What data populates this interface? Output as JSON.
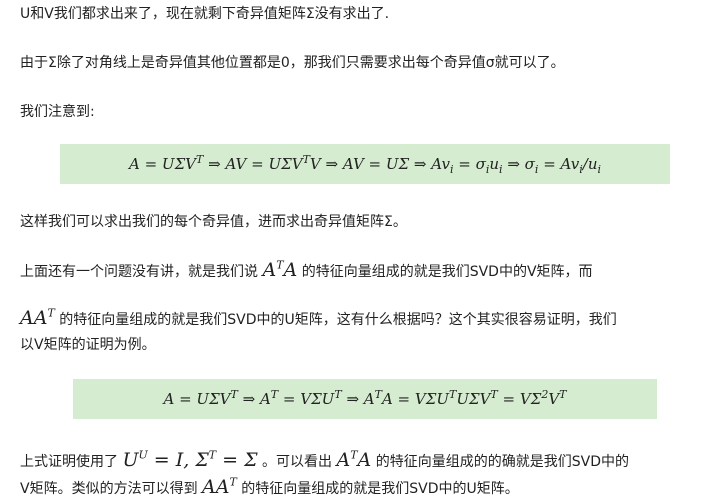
{
  "para1": "U和V我们都求出来了，现在就剩下奇异值矩阵Σ没有求出了.",
  "para2": "由于Σ除了对角线上是奇异值其他位置都是0，那我们只需要求出每个奇异值σ就可以了。",
  "para3": "我们注意到:",
  "para4": "这样我们可以求出我们的每个奇异值，进而求出奇异值矩阵Σ。",
  "para5_text_a": "上面还有一个问题没有讲，就是我们说",
  "para5_text_b": "的特征向量组成的就是我们SVD中的V矩阵，而",
  "para6_text_a": "的特征向量组成的就是我们SVD中的U矩阵，这有什么根据吗？这个其实很容易证明，我们",
  "para6_line2": "以V矩阵的证明为例。",
  "para7_text_a": "上式证明使用了",
  "para7_text_b": "。可以看出",
  "para7_text_c": "的特征向量组成的的确就是我们SVD中的",
  "para7_line2_a": "V矩阵。类似的方法可以得到",
  "para7_line2_b": "的特征向量组成的就是我们SVD中的U矩阵。",
  "colors": {
    "formula_bg": "#d5ecd0",
    "text": "#222222"
  }
}
